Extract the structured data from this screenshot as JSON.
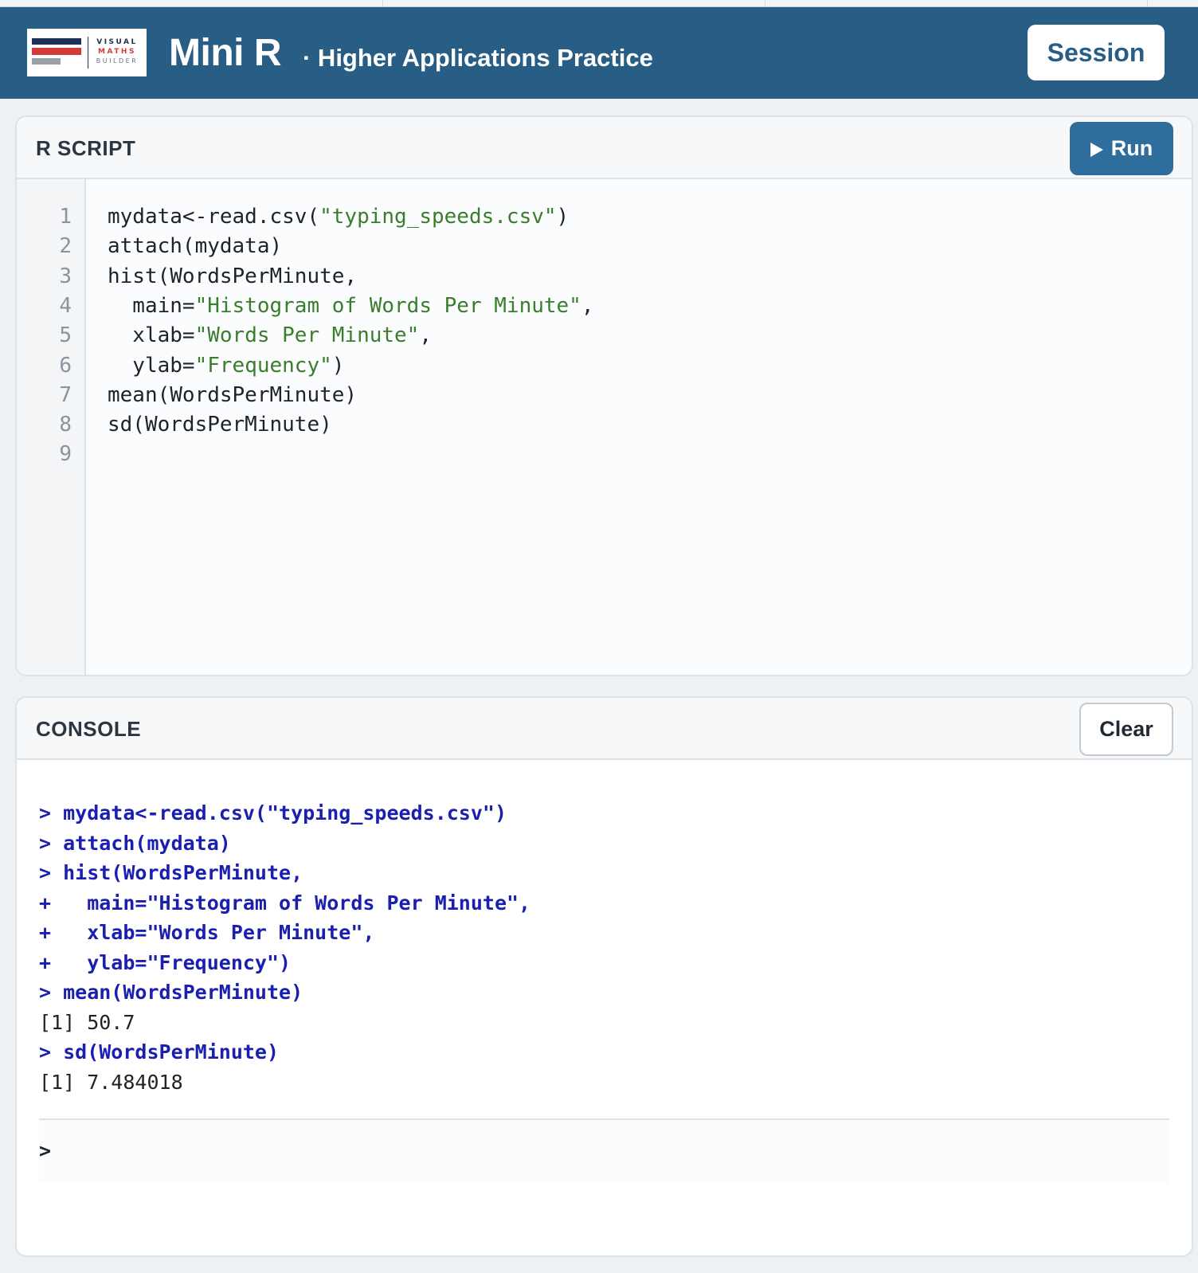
{
  "header": {
    "logo": {
      "line1": "VISUAL",
      "line2": "MATHS",
      "line3": "BUILDER"
    },
    "title": "Mini R",
    "subtitle": "· Higher Applications Practice",
    "session_label": "Session"
  },
  "script_panel": {
    "label": "R SCRIPT",
    "run_label": "Run",
    "line_numbers": [
      "1",
      "2",
      "3",
      "4",
      "5",
      "6",
      "7",
      "8",
      "9"
    ],
    "code": [
      [
        {
          "t": "mydata<-read.csv("
        },
        {
          "t": "\"typing_speeds.csv\"",
          "s": 1
        },
        {
          "t": ")"
        }
      ],
      [
        {
          "t": "attach(mydata)"
        }
      ],
      [
        {
          "t": "hist(WordsPerMinute,"
        }
      ],
      [
        {
          "t": "  main="
        },
        {
          "t": "\"Histogram of Words Per Minute\"",
          "s": 1
        },
        {
          "t": ","
        }
      ],
      [
        {
          "t": "  xlab="
        },
        {
          "t": "\"Words Per Minute\"",
          "s": 1
        },
        {
          "t": ","
        }
      ],
      [
        {
          "t": "  ylab="
        },
        {
          "t": "\"Frequency\"",
          "s": 1
        },
        {
          "t": ")"
        }
      ],
      [
        {
          "t": "mean(WordsPerMinute)"
        }
      ],
      [
        {
          "t": "sd(WordsPerMinute)"
        }
      ],
      []
    ]
  },
  "console_panel": {
    "label": "CONSOLE",
    "clear_label": "Clear",
    "lines": [
      {
        "kind": "cmd",
        "text": "> mydata<-read.csv(\"typing_speeds.csv\")"
      },
      {
        "kind": "cmd",
        "text": "> attach(mydata)"
      },
      {
        "kind": "cmd",
        "text": "> hist(WordsPerMinute,"
      },
      {
        "kind": "cmd",
        "text": "+   main=\"Histogram of Words Per Minute\","
      },
      {
        "kind": "cmd",
        "text": "+   xlab=\"Words Per Minute\","
      },
      {
        "kind": "cmd",
        "text": "+   ylab=\"Frequency\")"
      },
      {
        "kind": "cmd",
        "text": "> mean(WordsPerMinute)"
      },
      {
        "kind": "out",
        "text": "[1] 50.7"
      },
      {
        "kind": "cmd",
        "text": "> sd(WordsPerMinute)"
      },
      {
        "kind": "out",
        "text": "[1] 7.484018"
      }
    ],
    "prompt_symbol": ">",
    "input_value": ""
  },
  "colors": {
    "header_bg": "#285d85",
    "run_button": "#2f6d9d",
    "string_literal": "#3a7d2c",
    "console_command": "#1a1fb0"
  }
}
